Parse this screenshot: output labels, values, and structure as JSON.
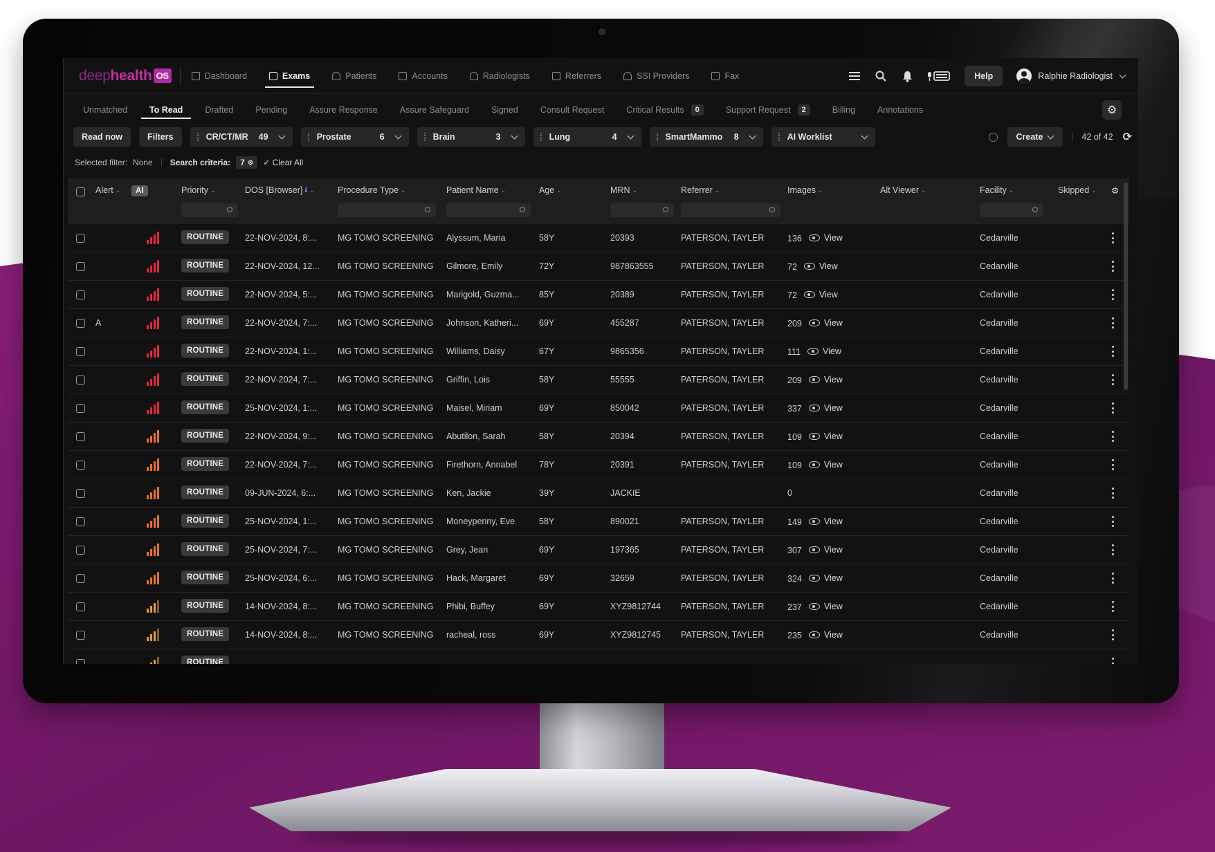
{
  "colors": {
    "accent": "#b22aa3",
    "background_purple": "#7a1a6c",
    "ai_red": "#e0283c",
    "ai_orange": "#e8702a",
    "ai_amber": "#e39a38"
  },
  "brand": {
    "deep": "deep",
    "health": "health",
    "os": "OS"
  },
  "nav": {
    "items": [
      {
        "label": "Dashboard",
        "icon": "dashboard-icon",
        "active": false
      },
      {
        "label": "Exams",
        "icon": "exams-icon",
        "active": true
      },
      {
        "label": "Patients",
        "icon": "patients-icon",
        "active": false
      },
      {
        "label": "Accounts",
        "icon": "accounts-icon",
        "active": false
      },
      {
        "label": "Radiologists",
        "icon": "radiologists-icon",
        "active": false
      },
      {
        "label": "Referrers",
        "icon": "referrers-icon",
        "active": false
      },
      {
        "label": "SSI Providers",
        "icon": "ssi-providers-icon",
        "active": false
      },
      {
        "label": "Fax",
        "icon": "fax-icon",
        "active": false
      }
    ],
    "help_label": "Help",
    "user_name": "Ralphie Radiologist"
  },
  "subtabs": [
    {
      "label": "Unmatched"
    },
    {
      "label": "To Read",
      "active": true
    },
    {
      "label": "Drafted"
    },
    {
      "label": "Pending"
    },
    {
      "label": "Assure Response"
    },
    {
      "label": "Assure Safeguard"
    },
    {
      "label": "Signed"
    },
    {
      "label": "Consult Request"
    },
    {
      "label": "Critical Results",
      "badge": "0"
    },
    {
      "label": "Support Request",
      "badge": "2"
    },
    {
      "label": "Billing"
    },
    {
      "label": "Annotations"
    }
  ],
  "toolbar": {
    "read_now": "Read now",
    "filters": "Filters",
    "worklists": [
      {
        "name": "CR/CT/MR",
        "count": "49"
      },
      {
        "name": "Prostate",
        "count": "6"
      },
      {
        "name": "Brain",
        "count": "3"
      },
      {
        "name": "Lung",
        "count": "4"
      },
      {
        "name": "SmartMammo",
        "count": "8"
      },
      {
        "name": "AI Worklist",
        "count": ""
      }
    ],
    "create_label": "Create",
    "count_text": "42 of 42"
  },
  "filter_row": {
    "selected_filter_label": "Selected filter:",
    "selected_filter_value": "None",
    "search_criteria_label": "Search criteria:",
    "search_criteria_count": "7",
    "clear_all": "Clear All"
  },
  "table": {
    "columns": {
      "alert": "Alert",
      "ai": "AI",
      "priority": "Priority",
      "dos": "DOS [Browser]",
      "procedure": "Procedure Type",
      "patient": "Patient Name",
      "age": "Age",
      "mrn": "MRN",
      "referrer": "Referrer",
      "images": "Images",
      "alt_viewer": "Alt Viewer",
      "facility": "Facility",
      "skipped": "Skipped"
    },
    "view_label": "View",
    "rows": [
      {
        "alert": "",
        "ai_level": "high",
        "priority": "ROUTINE",
        "dos": "22-NOV-2024, 8:...",
        "procedure": "MG TOMO SCREENING",
        "patient": "Alyssum, Maria",
        "age": "58Y",
        "mrn": "20393",
        "referrer": "PATERSON, TAYLER",
        "images": "136",
        "has_view": true,
        "facility": "Cedarville"
      },
      {
        "alert": "",
        "ai_level": "high",
        "priority": "ROUTINE",
        "dos": "22-NOV-2024, 12...",
        "procedure": "MG TOMO SCREENING",
        "patient": "Gilmore, Emily",
        "age": "72Y",
        "mrn": "987863555",
        "referrer": "PATERSON, TAYLER",
        "images": "72",
        "has_view": true,
        "facility": "Cedarville"
      },
      {
        "alert": "",
        "ai_level": "high",
        "priority": "ROUTINE",
        "dos": "22-NOV-2024, 5:...",
        "procedure": "MG TOMO SCREENING",
        "patient": "Marigold, Guzma...",
        "age": "85Y",
        "mrn": "20389",
        "referrer": "PATERSON, TAYLER",
        "images": "72",
        "has_view": true,
        "facility": "Cedarville"
      },
      {
        "alert": "A",
        "ai_level": "high",
        "priority": "ROUTINE",
        "dos": "22-NOV-2024, 7:...",
        "procedure": "MG TOMO SCREENING",
        "patient": "Johnson, Katheri...",
        "age": "69Y",
        "mrn": "455287",
        "referrer": "PATERSON, TAYLER",
        "images": "209",
        "has_view": true,
        "facility": "Cedarville"
      },
      {
        "alert": "",
        "ai_level": "high",
        "priority": "ROUTINE",
        "dos": "22-NOV-2024, 1:...",
        "procedure": "MG TOMO SCREENING",
        "patient": "Williams, Daisy",
        "age": "67Y",
        "mrn": "9865356",
        "referrer": "PATERSON, TAYLER",
        "images": "111",
        "has_view": true,
        "facility": "Cedarville"
      },
      {
        "alert": "",
        "ai_level": "high",
        "priority": "ROUTINE",
        "dos": "22-NOV-2024, 7:...",
        "procedure": "MG TOMO SCREENING",
        "patient": "Griffin, Lois",
        "age": "58Y",
        "mrn": "55555",
        "referrer": "PATERSON, TAYLER",
        "images": "209",
        "has_view": true,
        "facility": "Cedarville"
      },
      {
        "alert": "",
        "ai_level": "high",
        "priority": "ROUTINE",
        "dos": "25-NOV-2024, 1:...",
        "procedure": "MG TOMO SCREENING",
        "patient": "Maisel, Miriam",
        "age": "69Y",
        "mrn": "850042",
        "referrer": "PATERSON, TAYLER",
        "images": "337",
        "has_view": true,
        "facility": "Cedarville"
      },
      {
        "alert": "",
        "ai_level": "mid",
        "priority": "ROUTINE",
        "dos": "22-NOV-2024, 9:...",
        "procedure": "MG TOMO SCREENING",
        "patient": "Abutilon, Sarah",
        "age": "58Y",
        "mrn": "20394",
        "referrer": "PATERSON, TAYLER",
        "images": "109",
        "has_view": true,
        "facility": "Cedarville"
      },
      {
        "alert": "",
        "ai_level": "mid",
        "priority": "ROUTINE",
        "dos": "22-NOV-2024, 7:...",
        "procedure": "MG TOMO SCREENING",
        "patient": "Firethorn, Annabel",
        "age": "78Y",
        "mrn": "20391",
        "referrer": "PATERSON, TAYLER",
        "images": "109",
        "has_view": true,
        "facility": "Cedarville"
      },
      {
        "alert": "",
        "ai_level": "mid",
        "priority": "ROUTINE",
        "dos": "09-JUN-2024, 6:...",
        "procedure": "MG TOMO SCREENING",
        "patient": "Ken, Jackie",
        "age": "39Y",
        "mrn": "JACKIE",
        "referrer": "",
        "images": "0",
        "has_view": false,
        "facility": "Cedarville"
      },
      {
        "alert": "",
        "ai_level": "mid",
        "priority": "ROUTINE",
        "dos": "25-NOV-2024, 1:...",
        "procedure": "MG TOMO SCREENING",
        "patient": "Moneypenny, Eve",
        "age": "58Y",
        "mrn": "890021",
        "referrer": "PATERSON, TAYLER",
        "images": "149",
        "has_view": true,
        "facility": "Cedarville"
      },
      {
        "alert": "",
        "ai_level": "mid",
        "priority": "ROUTINE",
        "dos": "25-NOV-2024, 7:...",
        "procedure": "MG TOMO SCREENING",
        "patient": "Grey, Jean",
        "age": "69Y",
        "mrn": "197365",
        "referrer": "PATERSON, TAYLER",
        "images": "307",
        "has_view": true,
        "facility": "Cedarville"
      },
      {
        "alert": "",
        "ai_level": "mid",
        "priority": "ROUTINE",
        "dos": "25-NOV-2024, 6:...",
        "procedure": "MG TOMO SCREENING",
        "patient": "Hack, Margaret",
        "age": "69Y",
        "mrn": "32659",
        "referrer": "PATERSON, TAYLER",
        "images": "324",
        "has_view": true,
        "facility": "Cedarville"
      },
      {
        "alert": "",
        "ai_level": "low",
        "priority": "ROUTINE",
        "dos": "14-NOV-2024, 8:...",
        "procedure": "MG TOMO SCREENING",
        "patient": "Phibi, Buffey",
        "age": "69Y",
        "mrn": "XYZ9812744",
        "referrer": "PATERSON, TAYLER",
        "images": "237",
        "has_view": true,
        "facility": "Cedarville"
      },
      {
        "alert": "",
        "ai_level": "low",
        "priority": "ROUTINE",
        "dos": "14-NOV-2024, 8:...",
        "procedure": "MG TOMO SCREENING",
        "patient": "racheal, ross",
        "age": "69Y",
        "mrn": "XYZ9812745",
        "referrer": "PATERSON, TAYLER",
        "images": "235",
        "has_view": true,
        "facility": "Cedarville"
      },
      {
        "alert": "",
        "ai_level": "low",
        "priority": "ROUTINE",
        "dos": "",
        "procedure": "",
        "patient": "",
        "age": "",
        "mrn": "",
        "referrer": "",
        "images": "",
        "has_view": false,
        "facility": ""
      }
    ]
  }
}
